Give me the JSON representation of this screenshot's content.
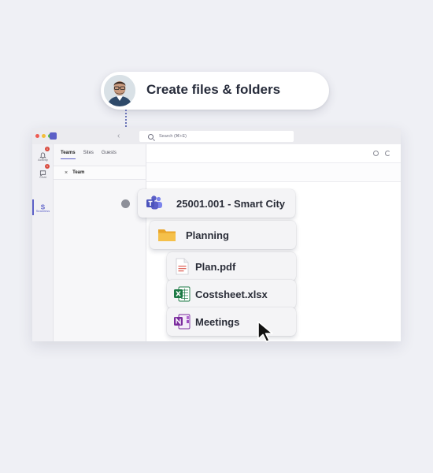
{
  "callout": {
    "text": "Create files & folders",
    "avatar_icon": "person-avatar"
  },
  "window": {
    "search_placeholder": "Search (⌘+E)",
    "back_glyph": "‹",
    "rail": [
      {
        "label": "Activity",
        "icon": "bell-icon",
        "badge": "1"
      },
      {
        "label": "Chat",
        "icon": "chat-icon",
        "badge": "1"
      },
      {
        "label": "Seamless",
        "icon": "seamless-logo-icon",
        "badge": ""
      }
    ],
    "tabs": [
      "Teams",
      "Sites",
      "Guests"
    ],
    "active_tab": "Teams",
    "team_row": {
      "close_glyph": "×",
      "label": "Team"
    }
  },
  "tree": {
    "project": {
      "label": "25001.001 - Smart City",
      "icon": "teams-icon"
    },
    "folder": {
      "label": "Planning",
      "icon": "folder-icon"
    },
    "files": [
      {
        "label": "Plan.pdf",
        "icon": "pdf-file-icon"
      },
      {
        "label": "Costsheet.xlsx",
        "icon": "excel-file-icon"
      },
      {
        "label": "Meetings",
        "icon": "onenote-file-icon"
      }
    ]
  },
  "colors": {
    "background": "#eff0f5",
    "teams_purple": "#5b5fc7",
    "folder_yellow": "#f5b83d",
    "pdf_red": "#d83a2e",
    "excel_green": "#1d7a45",
    "onenote_purple": "#7b2c9e"
  }
}
